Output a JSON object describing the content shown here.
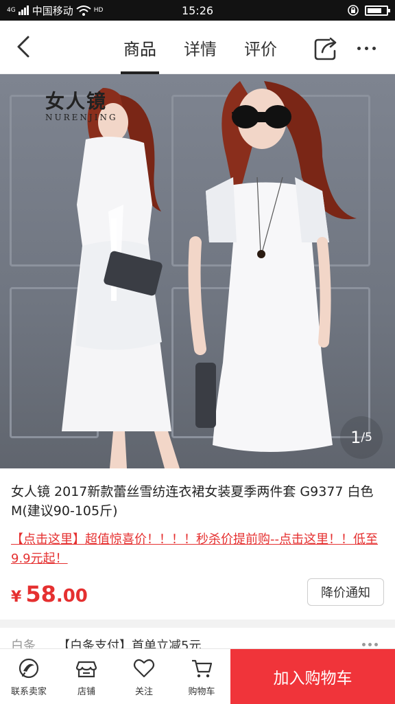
{
  "status_bar": {
    "carrier": "中国移动",
    "network": "4G",
    "hd": "HD",
    "time": "15:26",
    "battery_level": 0.8
  },
  "nav": {
    "tabs": [
      {
        "label": "商品",
        "active": true
      },
      {
        "label": "详情",
        "active": false
      },
      {
        "label": "评价",
        "active": false
      }
    ]
  },
  "gallery": {
    "brand_cn": "女人镜",
    "brand_en": "NURENJING",
    "current": "1",
    "total": "/5"
  },
  "product": {
    "title": "女人镜 2017新款蕾丝雪纺连衣裙女装夏季两件套 G9377 白色 M(建议90-105斤)",
    "promo": "【点击这里】超值惊喜价！！！！秒杀价提前购--点击这里！！低至9.9元起！",
    "price_symbol": "¥",
    "price_int": "58",
    "price_dec": ".00",
    "notify_label": "降价通知",
    "extra_label": "白条",
    "extra_text": "【白条支付】首单立减5元"
  },
  "bottom_bar": {
    "items": [
      {
        "label": "联系卖家",
        "icon": "chat-icon"
      },
      {
        "label": "店铺",
        "icon": "store-icon"
      },
      {
        "label": "关注",
        "icon": "heart-icon"
      },
      {
        "label": "购物车",
        "icon": "cart-icon"
      }
    ],
    "add_to_cart": "加入购物车"
  },
  "colors": {
    "accent": "#f0343a",
    "price": "#e53030"
  }
}
